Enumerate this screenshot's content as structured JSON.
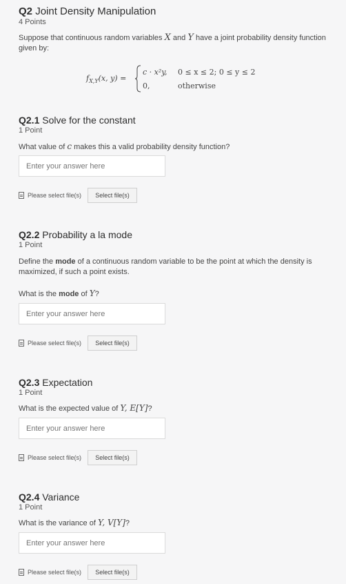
{
  "header": {
    "qnum": "Q2",
    "title": "Joint Density Manipulation",
    "points": "4 Points",
    "intro_pre": "Suppose that continuous random variables ",
    "intro_x": "X",
    "intro_and": " and ",
    "intro_y": "Y",
    "intro_post": " have a joint probability density function",
    "intro_line2": "given by:"
  },
  "formula": {
    "lhs": "f",
    "lhs_sub": "X,Y",
    "lhs_args": "(x, y) =",
    "case1_expr": "c · x²y,",
    "case1_cond": "0 ≤ x ≤ 2; 0 ≤ y ≤ 2",
    "case2_expr": "0,",
    "case2_cond": "otherwise"
  },
  "questions": [
    {
      "qnum": "Q2.1",
      "title": "Solve for the constant",
      "points": "1 Point",
      "prompt_pre": "What value of ",
      "prompt_var": "c",
      "prompt_post": " makes this a valid probability density function?",
      "placeholder": "Enter your answer here",
      "file_label": "Please select file(s)",
      "button": "Select file(s)"
    },
    {
      "qnum": "Q2.2",
      "title": "Probability a la mode",
      "points": "1 Point",
      "def_pre": "Define the ",
      "def_bold": "mode",
      "def_post": " of a continuous random variable to be the point at which the density is",
      "def_line2": "maximized, if such a point exists.",
      "prompt_pre": "What is the ",
      "prompt_bold": "mode",
      "prompt_mid": " of ",
      "prompt_var": "Y",
      "prompt_post": "?",
      "placeholder": "Enter your answer here",
      "file_label": "Please select file(s)",
      "button": "Select file(s)"
    },
    {
      "qnum": "Q2.3",
      "title": "Expectation",
      "points": "1 Point",
      "prompt_pre": "What is the expected value of ",
      "prompt_var": "Y, E[Y]",
      "prompt_post": "?",
      "placeholder": "Enter your answer here",
      "file_label": "Please select file(s)",
      "button": "Select file(s)"
    },
    {
      "qnum": "Q2.4",
      "title": "Variance",
      "points": "1 Point",
      "prompt_pre": "What is the variance of ",
      "prompt_var": "Y, V[Y]",
      "prompt_post": "?",
      "placeholder": "Enter your answer here",
      "file_label": "Please select file(s)",
      "button": "Select file(s)"
    }
  ]
}
